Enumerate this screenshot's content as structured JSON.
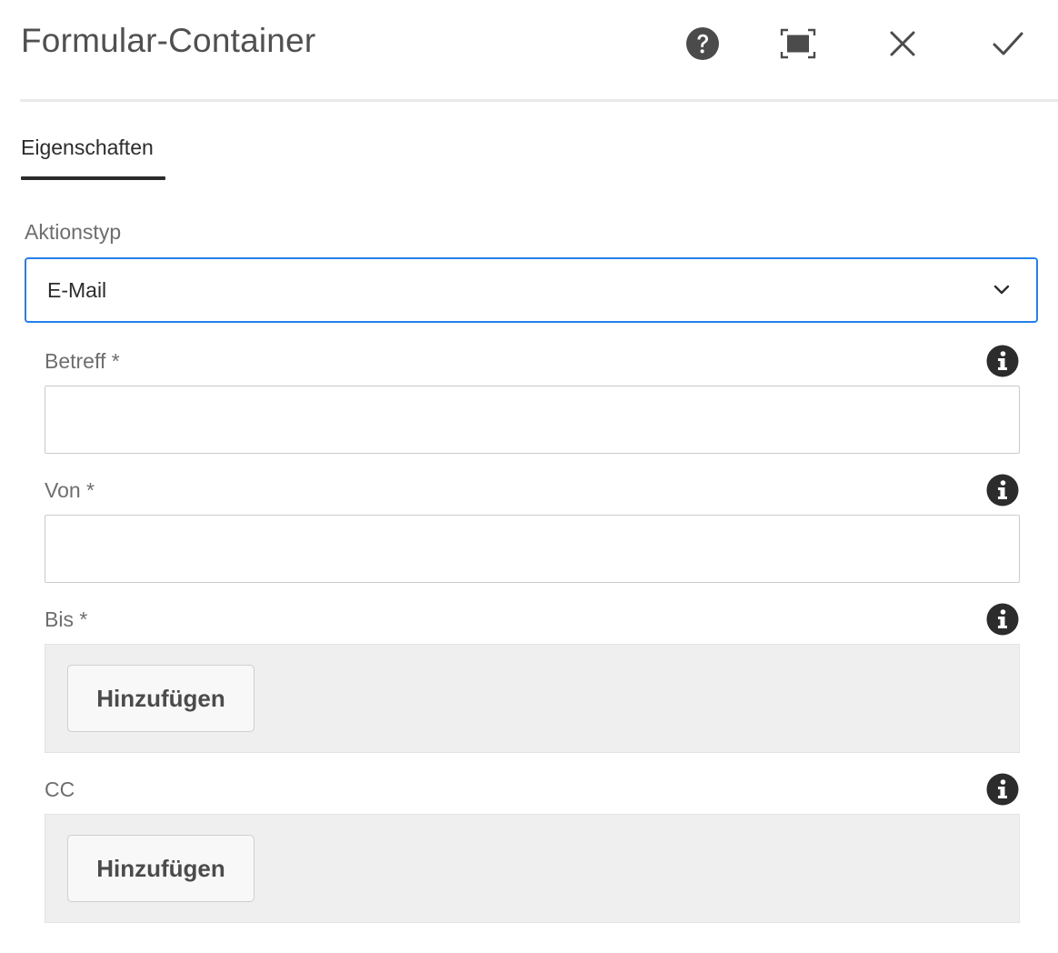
{
  "dialog": {
    "title": "Formular-Container",
    "header_icons": [
      "help-icon",
      "fullscreen-icon",
      "close-icon",
      "checkmark-icon"
    ]
  },
  "tabs": [
    {
      "label": "Eigenschaften",
      "selected": true
    }
  ],
  "form": {
    "action_type": {
      "label": "Aktionstyp",
      "value": "E-Mail"
    },
    "subject": {
      "label": "Betreff *",
      "value": ""
    },
    "from": {
      "label": "Von *",
      "value": ""
    },
    "to": {
      "label": "Bis *",
      "add_label": "Hinzufügen"
    },
    "cc": {
      "label": "CC",
      "add_label": "Hinzufügen"
    }
  },
  "colors": {
    "focus_border": "#2680eb",
    "tab_indicator": "#2c2c2c",
    "multifield_bg": "#efefef"
  }
}
